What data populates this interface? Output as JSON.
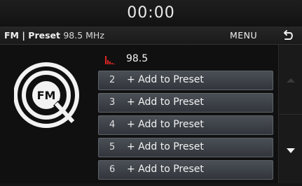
{
  "status": {
    "clock": "00:00"
  },
  "header": {
    "band": "FM",
    "separator": "|",
    "mode": "Preset",
    "frequency": "98.5 MHz",
    "menu_label": "MENU",
    "back_icon": "back-arrow-icon"
  },
  "logo": {
    "text": "FM",
    "icon": "fm-radio-icon"
  },
  "current": {
    "frequency": "98.5",
    "icon": "signal-strength-icon"
  },
  "presets": [
    {
      "number": "2",
      "label": "+ Add to Preset"
    },
    {
      "number": "3",
      "label": "+ Add to Preset"
    },
    {
      "number": "4",
      "label": "+ Add to Preset"
    },
    {
      "number": "5",
      "label": "+ Add to Preset"
    },
    {
      "number": "6",
      "label": "+ Add to Preset"
    }
  ],
  "scroll": {
    "up_icon": "scroll-up-icon",
    "down_icon": "scroll-down-icon"
  },
  "colors": {
    "accent": "#d12020",
    "row": "#3f444a"
  }
}
